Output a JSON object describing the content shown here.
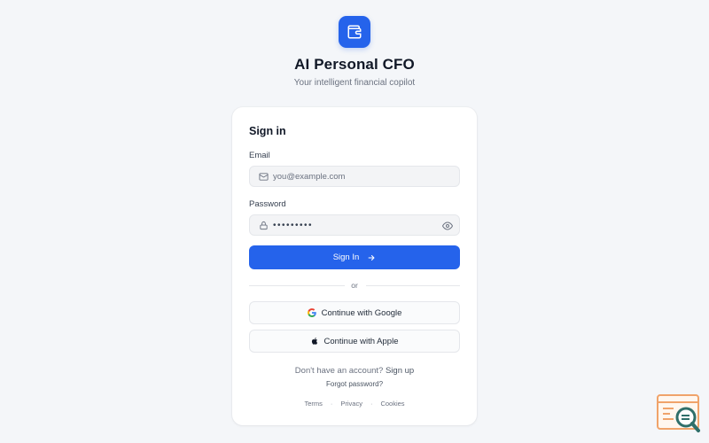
{
  "app": {
    "title": "AI Personal CFO",
    "subtitle": "Your intelligent financial copilot",
    "logo_icon": "wallet-icon",
    "accent_color": "#2563eb"
  },
  "signin": {
    "heading": "Sign in",
    "email": {
      "label": "Email",
      "placeholder": "you@example.com",
      "value": "",
      "icon": "mail-icon"
    },
    "password": {
      "label": "Password",
      "value": "•••••••••",
      "icon": "lock-icon",
      "toggle_icon": "eye-icon"
    },
    "submit_label": "Sign In",
    "submit_icon": "arrow-right-icon",
    "divider_text": "or",
    "google_label": "Continue with Google",
    "apple_label": "Continue with Apple",
    "no_account_text": "Don't have an account?",
    "signup_label": "Sign up",
    "forgot_label": "Forgot password?"
  },
  "footer": {
    "terms": "Terms",
    "privacy": "Privacy",
    "cookies": "Cookies",
    "separator": "·"
  }
}
